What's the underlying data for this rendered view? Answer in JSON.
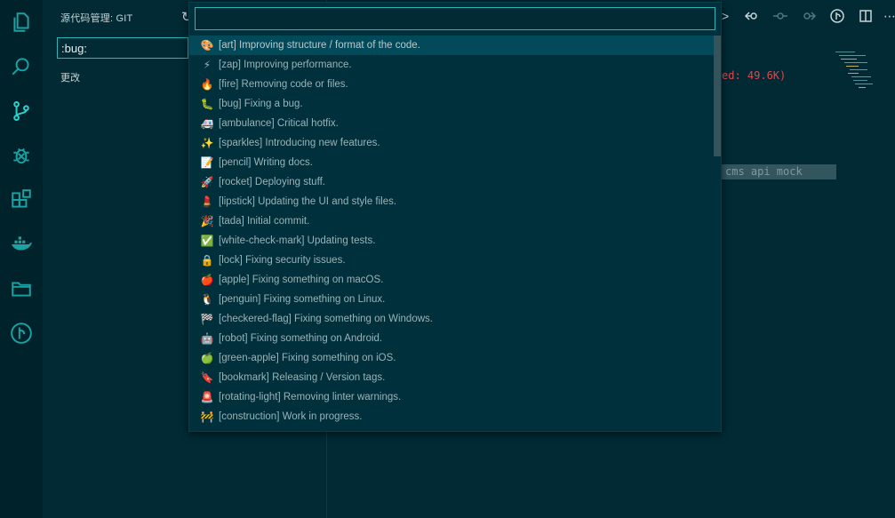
{
  "sidebar": {
    "title": "源代码管理: GIT",
    "commit_message": ":bug:",
    "changes_label": "更改"
  },
  "activity_bar": [
    {
      "name": "explorer-icon"
    },
    {
      "name": "search-icon"
    },
    {
      "name": "source-control-icon"
    },
    {
      "name": "debug-icon"
    },
    {
      "name": "extensions-icon"
    },
    {
      "name": "docker-icon"
    },
    {
      "name": "folder-icon"
    },
    {
      "name": "git-graph-icon"
    }
  ],
  "toolbar": {
    "icons": [
      "refresh-icon",
      "chevron-right-icon",
      "go-back-icon",
      "commit-node-icon",
      "go-forward-icon",
      "git-compare-icon",
      "split-editor-icon",
      "more-icon"
    ]
  },
  "terminal": {
    "line1": "ed: 49.6K)",
    "line2": "cms api mock"
  },
  "quick_pick": {
    "input_value": "",
    "items": [
      {
        "emoji": "🎨",
        "text": "[art] Improving structure / format of the code."
      },
      {
        "emoji": "⚡",
        "text": "[zap] Improving performance."
      },
      {
        "emoji": "🔥",
        "text": "[fire] Removing code or files."
      },
      {
        "emoji": "🐛",
        "text": "[bug] Fixing a bug."
      },
      {
        "emoji": "🚑",
        "text": "[ambulance] Critical hotfix."
      },
      {
        "emoji": "✨",
        "text": "[sparkles] Introducing new features."
      },
      {
        "emoji": "📝",
        "text": "[pencil] Writing docs."
      },
      {
        "emoji": "🚀",
        "text": "[rocket] Deploying stuff."
      },
      {
        "emoji": "💄",
        "text": "[lipstick] Updating the UI and style files."
      },
      {
        "emoji": "🎉",
        "text": "[tada] Initial commit."
      },
      {
        "emoji": "✅",
        "text": "[white-check-mark] Updating tests."
      },
      {
        "emoji": "🔒",
        "text": "[lock] Fixing security issues."
      },
      {
        "emoji": "🍎",
        "text": "[apple] Fixing something on macOS."
      },
      {
        "emoji": "🐧",
        "text": "[penguin] Fixing something on Linux."
      },
      {
        "emoji": "🏁",
        "text": "[checkered-flag] Fixing something on Windows."
      },
      {
        "emoji": "🤖",
        "text": "[robot] Fixing something on Android."
      },
      {
        "emoji": "🍏",
        "text": "[green-apple] Fixing something on iOS."
      },
      {
        "emoji": "🔖",
        "text": "[bookmark] Releasing / Version tags."
      },
      {
        "emoji": "🚨",
        "text": "[rotating-light] Removing linter warnings."
      },
      {
        "emoji": "🚧",
        "text": "[construction] Work in progress."
      }
    ]
  }
}
